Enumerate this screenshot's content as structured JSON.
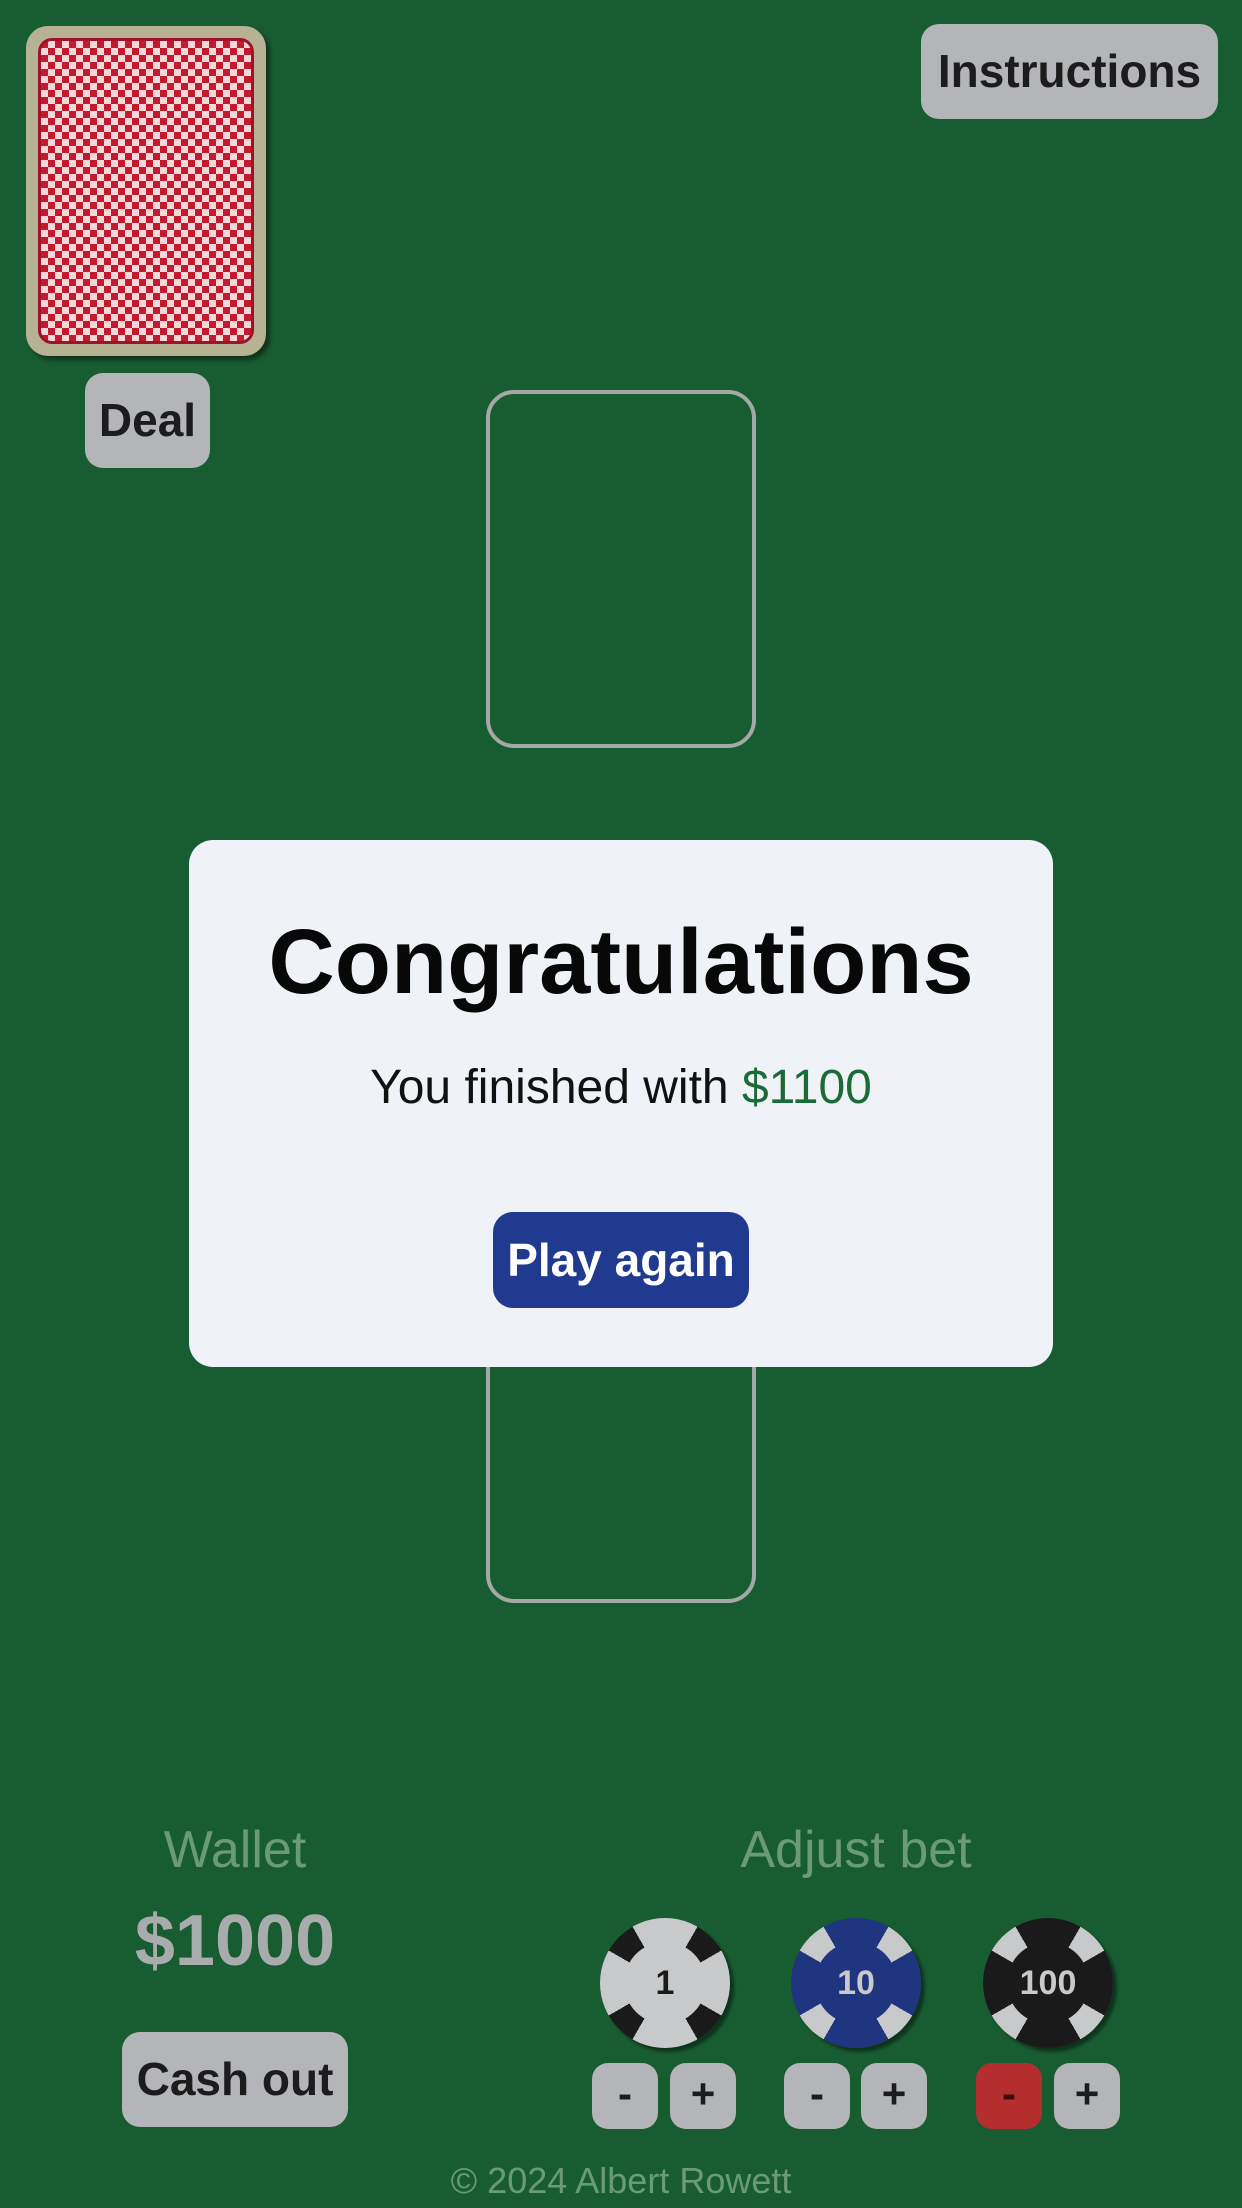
{
  "header": {
    "instructions_label": "Instructions"
  },
  "deck": {
    "deal_label": "Deal"
  },
  "modal": {
    "title": "Congratulations",
    "message": "You finished with",
    "amount": "$1100",
    "play_again_label": "Play again"
  },
  "wallet": {
    "label": "Wallet",
    "amount": "$1000",
    "cash_out_label": "Cash out"
  },
  "bet": {
    "label": "Adjust bet",
    "chips": [
      {
        "value": "1",
        "minus": "-",
        "plus": "+"
      },
      {
        "value": "10",
        "minus": "-",
        "plus": "+"
      },
      {
        "value": "100",
        "minus": "-",
        "plus": "+"
      }
    ]
  },
  "footer": {
    "text": "© 2024 Albert Rowett"
  },
  "colors": {
    "table": "#185d31",
    "modal_amount": "#1b6b36",
    "play_again": "#1f3a8f",
    "minus_active_red": "#b52e2e"
  }
}
